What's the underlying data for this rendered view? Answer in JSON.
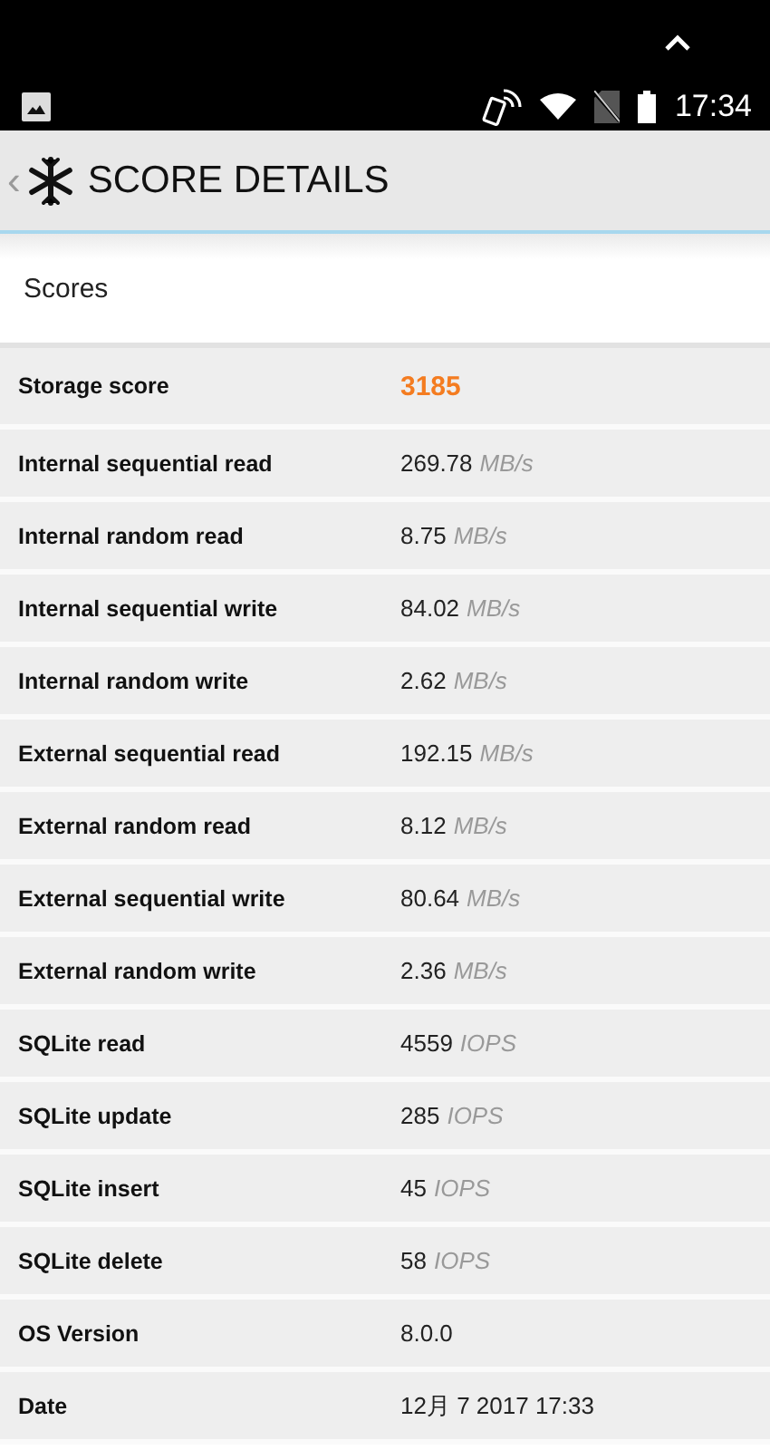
{
  "status_bar": {
    "time": "17:34"
  },
  "header": {
    "back": "‹",
    "title": "SCORE DETAILS"
  },
  "section": {
    "title": "Scores"
  },
  "rows": [
    {
      "kind": "score",
      "label": "Storage score",
      "value": "3185"
    },
    {
      "kind": "metric",
      "label": "Internal sequential read",
      "value": "269.78",
      "unit": "MB/s"
    },
    {
      "kind": "metric",
      "label": "Internal random read",
      "value": "8.75",
      "unit": "MB/s"
    },
    {
      "kind": "metric",
      "label": "Internal sequential write",
      "value": "84.02",
      "unit": "MB/s"
    },
    {
      "kind": "metric",
      "label": "Internal random write",
      "value": "2.62",
      "unit": "MB/s"
    },
    {
      "kind": "metric",
      "label": "External sequential read",
      "value": "192.15",
      "unit": "MB/s"
    },
    {
      "kind": "metric",
      "label": "External random read",
      "value": "8.12",
      "unit": "MB/s"
    },
    {
      "kind": "metric",
      "label": "External sequential write",
      "value": "80.64",
      "unit": "MB/s"
    },
    {
      "kind": "metric",
      "label": "External random write",
      "value": "2.36",
      "unit": "MB/s"
    },
    {
      "kind": "metric",
      "label": "SQLite read",
      "value": "4559",
      "unit": "IOPS"
    },
    {
      "kind": "metric",
      "label": "SQLite update",
      "value": "285",
      "unit": "IOPS"
    },
    {
      "kind": "metric",
      "label": "SQLite insert",
      "value": "45",
      "unit": "IOPS"
    },
    {
      "kind": "metric",
      "label": "SQLite delete",
      "value": "58",
      "unit": "IOPS"
    },
    {
      "kind": "metric",
      "label": "OS Version",
      "value": "8.0.0"
    },
    {
      "kind": "metric",
      "label": "Date",
      "value": "12月 7 2017 17:33"
    }
  ]
}
